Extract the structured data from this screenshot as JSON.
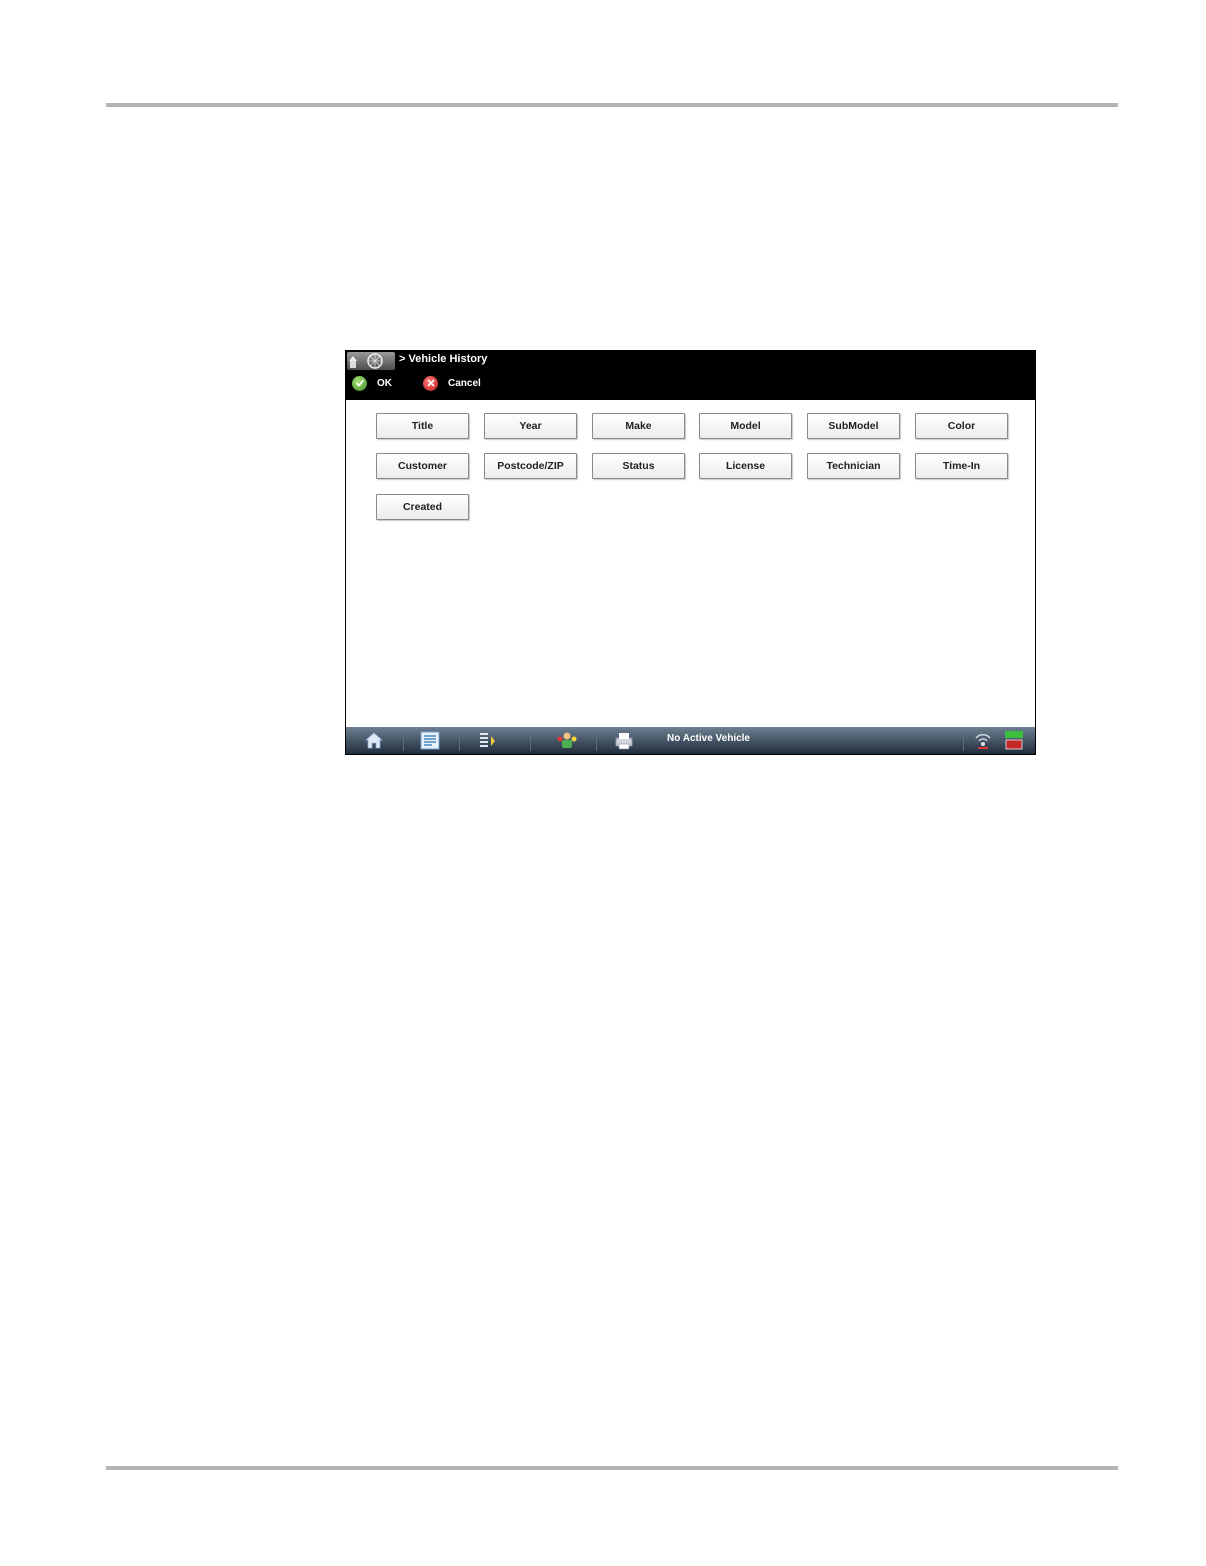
{
  "header": {
    "breadcrumb": "> Vehicle History"
  },
  "toolbar": {
    "ok_label": "OK",
    "cancel_label": "Cancel"
  },
  "sort_buttons": [
    "Title",
    "Year",
    "Make",
    "Model",
    "SubModel",
    "Color",
    "Customer",
    "Postcode/ZIP",
    "Status",
    "License",
    "Technician",
    "Time-In",
    "Created"
  ],
  "statusbar": {
    "vehicle_status": "No Active Vehicle",
    "icons": [
      "home-icon",
      "vehicle-list-icon",
      "sort-tools-icon",
      "technician-icon",
      "printer-icon",
      "connection-icon",
      "battery-icon"
    ]
  },
  "colors": {
    "titlebar": "#000000",
    "statusbar": "#2b3a4a",
    "ok": "#3d8e1d",
    "cancel": "#c01515"
  }
}
